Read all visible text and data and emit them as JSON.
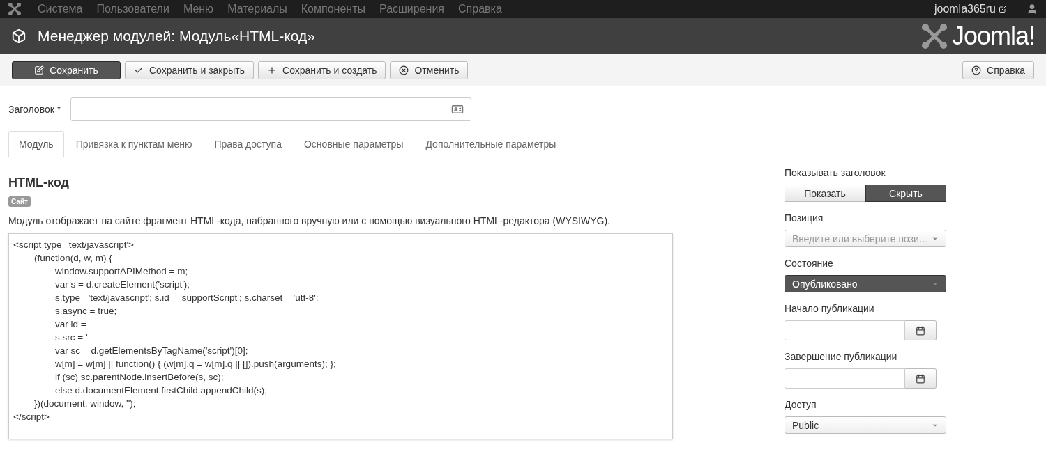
{
  "navbar": {
    "menu": [
      "Система",
      "Пользователи",
      "Меню",
      "Материалы",
      "Компоненты",
      "Расширения",
      "Справка"
    ],
    "site_link": "joomla365ru"
  },
  "header": {
    "title": "Менеджер модулей: Модуль«HTML-код»",
    "brand": "Joomla!"
  },
  "toolbar": {
    "buttons": [
      {
        "label": "Сохранить",
        "kind": "edit",
        "primary": true
      },
      {
        "label": "Сохранить и закрыть",
        "kind": "check",
        "primary": false
      },
      {
        "label": "Сохранить и создать",
        "kind": "plus",
        "primary": false
      },
      {
        "label": "Отменить",
        "kind": "cancel",
        "primary": false
      }
    ],
    "help": "Справка"
  },
  "title_field": {
    "label": "Заголовок *"
  },
  "tabs": [
    {
      "label": "Модуль",
      "selected": true
    },
    {
      "label": "Привязка к пунктам меню",
      "selected": false
    },
    {
      "label": "Права доступа",
      "selected": false
    },
    {
      "label": "Основные параметры",
      "selected": false
    },
    {
      "label": "Дополнительные параметры",
      "selected": false
    }
  ],
  "module": {
    "heading": "HTML-код",
    "badge": "Сайт",
    "description": "Модуль отображает на сайте фрагмент HTML-кода, набранного вручную или с помощью визуального HTML-редактора (WYSIWYG).",
    "code": "<script type='text/javascript'>\n\t(function(d, w, m) {\n\t\twindow.supportAPIMethod = m;\n\t\tvar s = d.createElement('script');\n\t\ts.type ='text/javascript'; s.id = 'supportScript'; s.charset = 'utf-8';\n\t\ts.async = true;\n\t\tvar id =\n\t\ts.src = '\n\t\tvar sc = d.getElementsByTagName('script')[0];\n\t\tw[m] = w[m] || function() { (w[m].q = w[m].q || []).push(arguments); };\n\t\tif (sc) sc.parentNode.insertBefore(s, sc);\n\t\telse d.documentElement.firstChild.appendChild(s);\n\t})(document, window, '');\n</script>"
  },
  "sidebar": [
    {
      "kind": "toggle",
      "label": "Показывать заголовок",
      "options": [
        {
          "label": "Показать",
          "selected": false
        },
        {
          "label": "Скрыть",
          "selected": true
        }
      ]
    },
    {
      "kind": "select",
      "label": "Позиция",
      "placeholder": "Введите или выберите пози…",
      "dark": false
    },
    {
      "kind": "select",
      "label": "Состояние",
      "value": "Опубликовано",
      "dark": true
    },
    {
      "kind": "date",
      "label": "Начало публикации"
    },
    {
      "kind": "date",
      "label": "Завершение публикации"
    },
    {
      "kind": "select",
      "label": "Доступ",
      "value": "Public",
      "dark": false
    }
  ]
}
